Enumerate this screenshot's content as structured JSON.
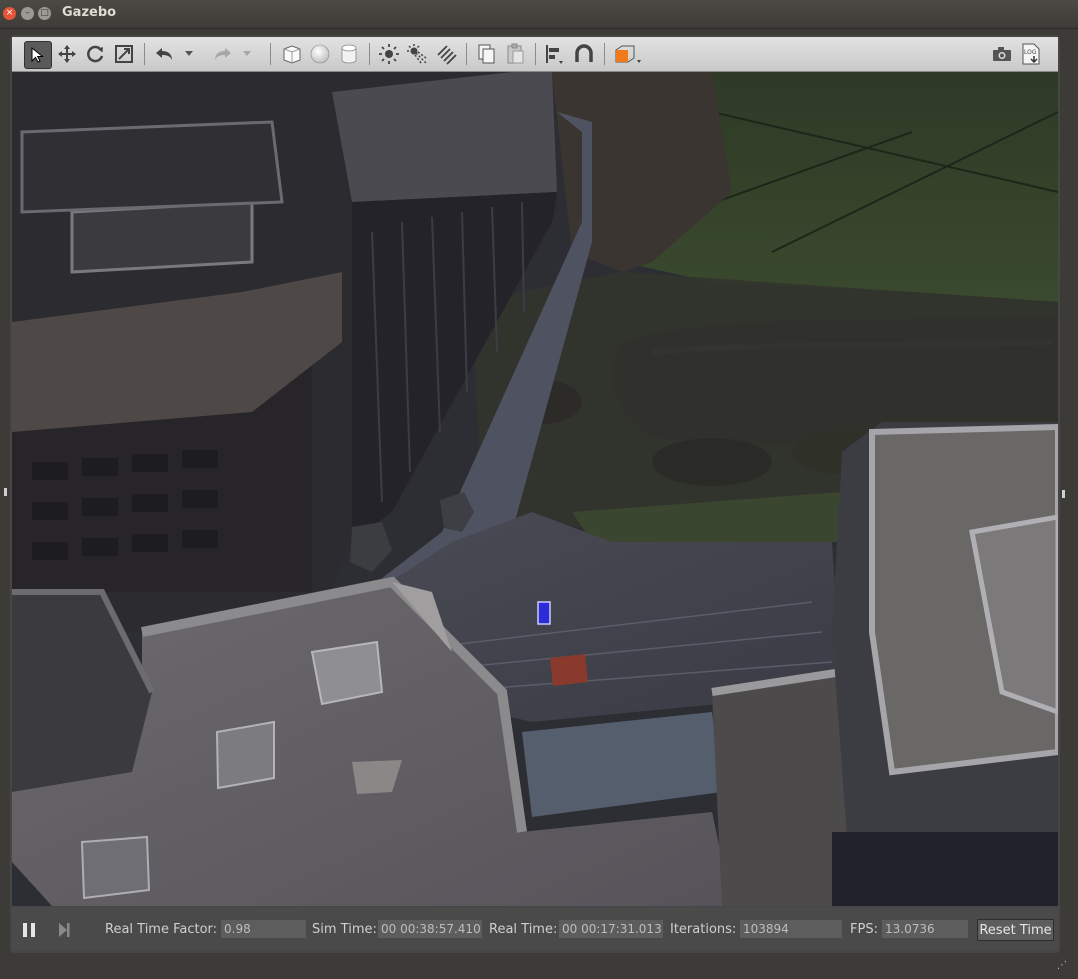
{
  "window": {
    "title": "Gazebo"
  },
  "toolbar": {
    "tools": [
      {
        "name": "select-mode",
        "icon": "arrow-cursor-icon"
      },
      {
        "name": "translate-mode",
        "icon": "move-icon"
      },
      {
        "name": "rotate-mode",
        "icon": "rotate-icon"
      },
      {
        "name": "scale-mode",
        "icon": "scale-icon"
      },
      {
        "name": "undo",
        "icon": "undo-icon"
      },
      {
        "name": "redo",
        "icon": "redo-icon"
      },
      {
        "name": "box",
        "icon": "box-icon"
      },
      {
        "name": "sphere",
        "icon": "sphere-icon"
      },
      {
        "name": "cylinder",
        "icon": "cylinder-icon"
      },
      {
        "name": "point-light",
        "icon": "point-light-icon"
      },
      {
        "name": "spot-light",
        "icon": "spot-light-icon"
      },
      {
        "name": "directional-light",
        "icon": "directional-light-icon"
      },
      {
        "name": "copy",
        "icon": "copy-icon"
      },
      {
        "name": "paste",
        "icon": "paste-icon"
      },
      {
        "name": "align",
        "icon": "align-icon"
      },
      {
        "name": "snap",
        "icon": "magnet-icon"
      },
      {
        "name": "view-angle",
        "icon": "view-cube-icon"
      },
      {
        "name": "screenshot",
        "icon": "camera-icon"
      },
      {
        "name": "log",
        "icon": "log-icon",
        "label": "LOG"
      }
    ],
    "accent_color": "#f07a1a"
  },
  "status": {
    "real_time_factor_label": "Real Time Factor:",
    "real_time_factor": "0.98",
    "sim_time_label": "Sim Time:",
    "sim_time": "00 00:38:57.410",
    "real_time_label": "Real Time:",
    "real_time": "00 00:17:31.013",
    "iterations_label": "Iterations:",
    "iterations": "103894",
    "fps_label": "FPS:",
    "fps": "13.0736",
    "reset_time_label": "Reset Time"
  }
}
